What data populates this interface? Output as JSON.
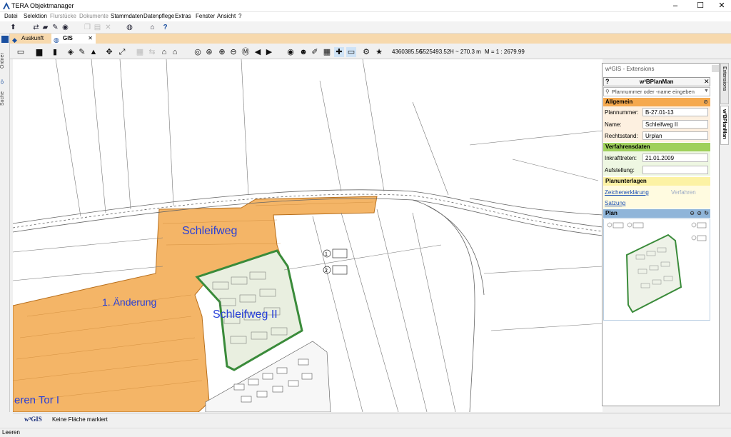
{
  "window": {
    "title": "TERA Objektmanager",
    "minimize": "–",
    "maximize": "☐",
    "close": "✕"
  },
  "menu": [
    {
      "label": "Datei",
      "enabled": true
    },
    {
      "label": "Selektion",
      "enabled": true
    },
    {
      "label": "Flurstücke",
      "enabled": false
    },
    {
      "label": "Dokumente",
      "enabled": false
    },
    {
      "label": "Stammdaten",
      "enabled": true
    },
    {
      "label": "Datenpflege",
      "enabled": true
    },
    {
      "label": "Extras",
      "enabled": true
    },
    {
      "label": "Fenster",
      "enabled": true
    },
    {
      "label": "Ansicht",
      "enabled": true
    },
    {
      "label": "?",
      "enabled": true
    }
  ],
  "toolbar_icons": {
    "main": [
      "pin-icon",
      "filter-icon",
      "folder-open-icon",
      "tools-icon",
      "gis-icon",
      "copy-icon",
      "paste-icon",
      "cut-icon",
      "delete-icon",
      "globe-icon",
      "bookmark-icon",
      "help-icon"
    ],
    "map": [
      "rectangle-select-icon",
      "print-icon",
      "bookmark-icon",
      "layers-icon",
      "pen-icon",
      "terrain-icon",
      "crosshair-icon",
      "fit-extent-icon",
      "grid-icon",
      "swap-icon",
      "home-icon",
      "buildings-icon",
      "circle-select-icon",
      "pan-icon",
      "zoom-in-icon",
      "zoom-out-icon",
      "measure-icon",
      "back-icon",
      "forward-icon",
      "target-icon",
      "layer-visible-icon",
      "person-icon",
      "edit-icon",
      "table-icon",
      "puzzle-icon",
      "comment-icon",
      "gear-icon",
      "star-icon"
    ]
  },
  "tabs": [
    {
      "label": "Auskunft",
      "active": false
    },
    {
      "label": "GIS",
      "active": true
    }
  ],
  "side_tabs": [
    "Ordner",
    "Suche"
  ],
  "map_readout": {
    "x": "4360385.56",
    "y": "5525493.52",
    "height": "H ~ 270.3  m",
    "scale": "M = 1 :  2679.99"
  },
  "map_labels": {
    "schleifweg": "Schleifweg",
    "schleifweg2": "Schleifweg II",
    "aenderung": "1. Änderung",
    "tor": "eren Tor I"
  },
  "colors": {
    "plan_orange": "#f2a84c",
    "plan_green": "#3a8b3a",
    "label_blue": "#2840d8",
    "section_orange": "#f5a94e",
    "section_green": "#9fd05c",
    "section_yellow": "#fcf2a4",
    "section_blue": "#8fb5d9"
  },
  "panel": {
    "window_title": "w³GIS - Extensions",
    "title": "w³BPlanMan",
    "help": "?",
    "close": "✕",
    "search_placeholder": "Plannummer oder -name eingeben",
    "vertical_tabs": [
      "Extensions",
      "w³BPlanMan"
    ],
    "allgemein": {
      "header": "Allgemein",
      "plannummer_label": "Plannummer:",
      "plannummer_value": "B-27.01-13",
      "name_label": "Name:",
      "name_value": "Schleifweg II",
      "rechtsstand_label": "Rechtsstand:",
      "rechtsstand_value": "Urplan"
    },
    "verfahrensdaten": {
      "header": "Verfahrensdaten",
      "inkrafttreten_label": "Inkrafttreten:",
      "inkrafttreten_value": "21.01.2009",
      "aufstellung_label": "Aufstellung:",
      "aufstellung_value": ""
    },
    "planunterlagen": {
      "header": "Planunterlagen",
      "zeichenerklaerung": "Zeichenerklärung",
      "verfahren": "Verfahren",
      "satzung": "Satzung"
    },
    "plan": {
      "header": "Plan"
    }
  },
  "map_status": {
    "logo": "w³GIS",
    "message": "Keine Fläche markiert"
  },
  "app_status": "Leeren"
}
